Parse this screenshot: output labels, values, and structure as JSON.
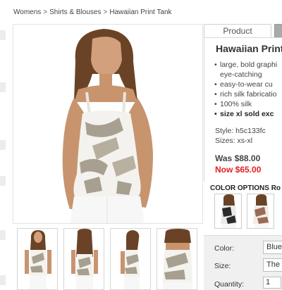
{
  "breadcrumb": {
    "items": [
      "Womens",
      "Shirts & Blouses",
      "Hawaiian Print Tank"
    ],
    "separator": ">"
  },
  "tabs": {
    "product": "Product"
  },
  "product": {
    "title": "Hawaiian Print",
    "features": [
      "large, bold graphi",
      "eye-catching",
      "easy-to-wear cu",
      "rich silk fabricatio",
      "100% silk",
      "size xl sold exc"
    ],
    "style": "Style: h5c133fc",
    "sizes": "Sizes: xs-xl",
    "was_price": "Was $88.00",
    "now_price": "Now $65.00"
  },
  "color_options": {
    "label": "COLOR OPTIONS",
    "label_suffix": "Ro"
  },
  "form": {
    "color_label": "Color:",
    "color_value": "Blue",
    "size_label": "Size:",
    "size_value": "The",
    "quantity_label": "Quantity:",
    "quantity_value": "1"
  },
  "colors": {
    "now_price": "#e02020",
    "tank_print": "#a79f8f",
    "tank_base": "#f4f2ee",
    "skin": "#c8946e",
    "hair": "#6a4326",
    "shorts": "#f7f7f7"
  }
}
